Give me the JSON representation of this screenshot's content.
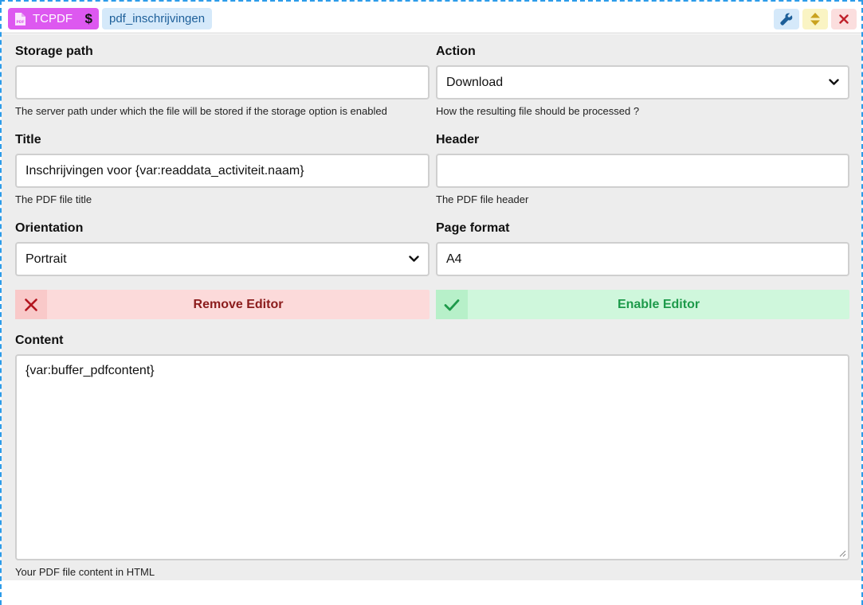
{
  "header": {
    "type_badge": "TCPDF",
    "type_suffix": "$",
    "name_badge": "pdf_inschrijvingen"
  },
  "form": {
    "storage_path": {
      "label": "Storage path",
      "value": "",
      "hint": "The server path under which the file will be stored if the storage option is enabled"
    },
    "action": {
      "label": "Action",
      "value": "Download",
      "hint": "How the resulting file should be processed ?"
    },
    "title": {
      "label": "Title",
      "value": "Inschrijvingen voor {var:readdata_activiteit.naam}",
      "hint": "The PDF file title"
    },
    "header_field": {
      "label": "Header",
      "value": "",
      "hint": "The PDF file header"
    },
    "orientation": {
      "label": "Orientation",
      "value": "Portrait"
    },
    "page_format": {
      "label": "Page format",
      "value": "A4"
    },
    "content": {
      "label": "Content",
      "value": "{var:buffer_pdfcontent}",
      "hint": "Your PDF file content in HTML"
    }
  },
  "buttons": {
    "remove_editor": "Remove Editor",
    "enable_editor": "Enable Editor"
  },
  "icons": {
    "pdf": "pdf-file-icon",
    "dollar": "dollar-icon",
    "wrench": "wrench-icon",
    "sort": "sort-icon",
    "close": "close-icon",
    "chevron": "chevron-down-icon",
    "x": "x-icon",
    "check": "check-icon"
  },
  "colors": {
    "frame_border": "#2b9be9",
    "tcpdf_badge": "#dd58f0",
    "name_badge_bg": "#d5e9fa",
    "remove_bg": "#fcdada",
    "remove_text": "#8b1c1c",
    "enable_bg": "#cff7dc",
    "enable_text": "#1d9a4a"
  }
}
